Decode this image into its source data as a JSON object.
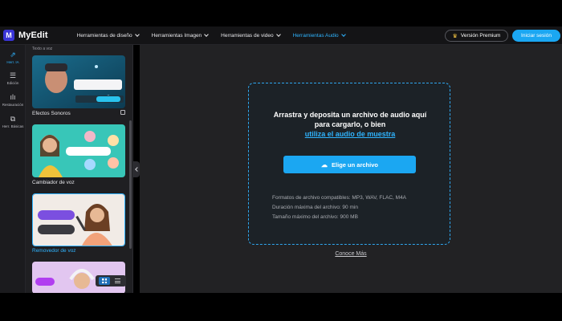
{
  "app": {
    "name": "MyEdit",
    "logo_letter": "M"
  },
  "nav": {
    "items": [
      {
        "label": "Herramientas de diseño",
        "active": false
      },
      {
        "label": "Herramientas Imagen",
        "active": false
      },
      {
        "label": "Herramientas de video",
        "active": false
      },
      {
        "label": "Herramientas Audio",
        "active": true
      }
    ],
    "premium_label": "Versión Premium",
    "login_label": "Iniciar sesión"
  },
  "rail": {
    "items": [
      {
        "icon": "magic-wand-icon",
        "label": "Herr. IA",
        "active": true
      },
      {
        "icon": "sliders-icon",
        "label": "Edición",
        "active": false
      },
      {
        "icon": "waveform-icon",
        "label": "Restauración",
        "active": false
      },
      {
        "icon": "copy-icon",
        "label": "Herr. Básicas",
        "active": false
      }
    ]
  },
  "panel": {
    "top_text": "Texto a voz",
    "cards": [
      {
        "label": "Efectos Sonoros",
        "badge": "SFX",
        "prompt": "Bubble...",
        "button": "Generate"
      },
      {
        "label": "Cambiador de voz"
      },
      {
        "label": "Removedor de voz",
        "active": true
      },
      {
        "label": ""
      }
    ]
  },
  "main": {
    "drop_title_line1": "Arrastra y deposita un archivo de audio aquí",
    "drop_title_line2": "para cargarlo, o bien",
    "sample_link": "utiliza el audio de muestra",
    "choose_button": "Elige un archivo",
    "info_formats": "Formatos de archivo compatibles: MP3, WAV, FLAC, M4A",
    "info_duration": "Duración máxima del archivo: 90 min",
    "info_size": "Tamaño máximo del archivo: 900 MB",
    "learn_more": "Conoce Más"
  },
  "colors": {
    "accent": "#1ba7f2",
    "logo": "#3a35d6",
    "active_text": "#2fb4ff"
  }
}
